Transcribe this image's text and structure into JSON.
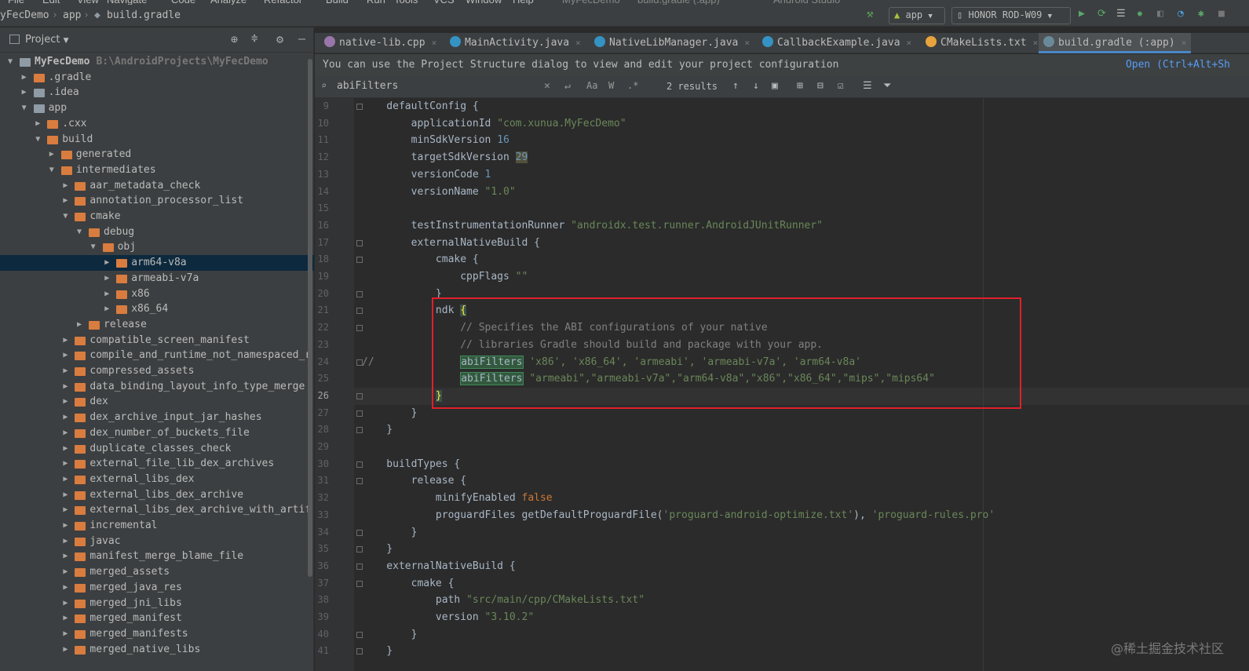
{
  "menu": [
    "File",
    "Edit",
    "View",
    "Navigate",
    "Code",
    "Analyze",
    "Refactor",
    "Build",
    "Run",
    "Tools",
    "VCS",
    "Window",
    "Help",
    "MyFecDemo",
    "build.gradle (:app)",
    "Android Studio"
  ],
  "navbar": {
    "crumbs": [
      "yFecDemo",
      "app",
      "build.gradle"
    ],
    "run_config": "app",
    "device": "HONOR ROD-W09"
  },
  "project_panel": {
    "title": "Project",
    "tree": [
      {
        "label": "MyFecDemo",
        "path": "B:\\AndroidProjects\\MyFecDemo",
        "depth": 0,
        "open": true,
        "grey": true,
        "bold": true
      },
      {
        "label": ".gradle",
        "depth": 1,
        "open": false
      },
      {
        "label": ".idea",
        "depth": 1,
        "open": false,
        "grey": true
      },
      {
        "label": "app",
        "depth": 1,
        "open": true,
        "grey": true
      },
      {
        "label": ".cxx",
        "depth": 2,
        "open": false
      },
      {
        "label": "build",
        "depth": 2,
        "open": true
      },
      {
        "label": "generated",
        "depth": 3,
        "open": false
      },
      {
        "label": "intermediates",
        "depth": 3,
        "open": true
      },
      {
        "label": "aar_metadata_check",
        "depth": 4,
        "open": false
      },
      {
        "label": "annotation_processor_list",
        "depth": 4,
        "open": false
      },
      {
        "label": "cmake",
        "depth": 4,
        "open": true
      },
      {
        "label": "debug",
        "depth": 5,
        "open": true
      },
      {
        "label": "obj",
        "depth": 6,
        "open": true
      },
      {
        "label": "arm64-v8a",
        "depth": 7,
        "open": false,
        "selected": true
      },
      {
        "label": "armeabi-v7a",
        "depth": 7,
        "open": false
      },
      {
        "label": "x86",
        "depth": 7,
        "open": false
      },
      {
        "label": "x86_64",
        "depth": 7,
        "open": false
      },
      {
        "label": "release",
        "depth": 5,
        "open": false
      },
      {
        "label": "compatible_screen_manifest",
        "depth": 4,
        "open": false
      },
      {
        "label": "compile_and_runtime_not_namespaced_r",
        "depth": 4,
        "open": false
      },
      {
        "label": "compressed_assets",
        "depth": 4,
        "open": false
      },
      {
        "label": "data_binding_layout_info_type_merge",
        "depth": 4,
        "open": false
      },
      {
        "label": "dex",
        "depth": 4,
        "open": false
      },
      {
        "label": "dex_archive_input_jar_hashes",
        "depth": 4,
        "open": false
      },
      {
        "label": "dex_number_of_buckets_file",
        "depth": 4,
        "open": false
      },
      {
        "label": "duplicate_classes_check",
        "depth": 4,
        "open": false
      },
      {
        "label": "external_file_lib_dex_archives",
        "depth": 4,
        "open": false
      },
      {
        "label": "external_libs_dex",
        "depth": 4,
        "open": false
      },
      {
        "label": "external_libs_dex_archive",
        "depth": 4,
        "open": false
      },
      {
        "label": "external_libs_dex_archive_with_artif",
        "depth": 4,
        "open": false
      },
      {
        "label": "incremental",
        "depth": 4,
        "open": false
      },
      {
        "label": "javac",
        "depth": 4,
        "open": false
      },
      {
        "label": "manifest_merge_blame_file",
        "depth": 4,
        "open": false
      },
      {
        "label": "merged_assets",
        "depth": 4,
        "open": false
      },
      {
        "label": "merged_java_res",
        "depth": 4,
        "open": false
      },
      {
        "label": "merged_jni_libs",
        "depth": 4,
        "open": false
      },
      {
        "label": "merged_manifest",
        "depth": 4,
        "open": false
      },
      {
        "label": "merged_manifests",
        "depth": 4,
        "open": false
      },
      {
        "label": "merged_native_libs",
        "depth": 4,
        "open": false
      }
    ]
  },
  "tabs": [
    {
      "label": "native-lib.cpp",
      "icon_color": "#9876aa",
      "active": false
    },
    {
      "label": "MainActivity.java",
      "icon_color": "#3592c4",
      "active": false
    },
    {
      "label": "NativeLibManager.java",
      "icon_color": "#3592c4",
      "active": false
    },
    {
      "label": "CallbackExample.java",
      "icon_color": "#3592c4",
      "active": false
    },
    {
      "label": "CMakeLists.txt",
      "icon_color": "#e8a33d",
      "active": false
    },
    {
      "label": "build.gradle (:app)",
      "icon_color": "#6a8a9a",
      "active": true
    }
  ],
  "notice": {
    "text": "You can use the Project Structure dialog to view and edit your project configuration",
    "link": "Open (Ctrl+Alt+Sh"
  },
  "find": {
    "query": "abiFilters",
    "results": "2 results",
    "match_case": "Aa",
    "words": "W",
    "regex": ".*"
  },
  "editor": {
    "current_line": 26,
    "lines": [
      {
        "n": 9,
        "tokens": [
          [
            "ident",
            "    defaultConfig {"
          ]
        ]
      },
      {
        "n": 10,
        "tokens": [
          [
            "ident",
            "        applicationId "
          ],
          [
            "str",
            "\"com.xunua.MyFecDemo\""
          ]
        ]
      },
      {
        "n": 11,
        "tokens": [
          [
            "ident",
            "        minSdkVersion "
          ],
          [
            "num",
            "16"
          ]
        ]
      },
      {
        "n": 12,
        "tokens": [
          [
            "ident",
            "        targetSdkVersion "
          ],
          [
            "warn",
            "29"
          ]
        ]
      },
      {
        "n": 13,
        "tokens": [
          [
            "ident",
            "        versionCode "
          ],
          [
            "num",
            "1"
          ]
        ]
      },
      {
        "n": 14,
        "tokens": [
          [
            "ident",
            "        versionName "
          ],
          [
            "str",
            "\"1.0\""
          ]
        ]
      },
      {
        "n": 15,
        "tokens": []
      },
      {
        "n": 16,
        "tokens": [
          [
            "ident",
            "        testInstrumentationRunner "
          ],
          [
            "str",
            "\"androidx.test.runner.AndroidJUnitRunner\""
          ]
        ]
      },
      {
        "n": 17,
        "tokens": [
          [
            "ident",
            "        externalNativeBuild {"
          ]
        ]
      },
      {
        "n": 18,
        "tokens": [
          [
            "ident",
            "            cmake {"
          ]
        ]
      },
      {
        "n": 19,
        "tokens": [
          [
            "ident",
            "                cppFlags "
          ],
          [
            "str",
            "\"\""
          ]
        ]
      },
      {
        "n": 20,
        "tokens": [
          [
            "ident",
            "            }"
          ]
        ]
      },
      {
        "n": 21,
        "tokens": [
          [
            "ident",
            "            ndk "
          ],
          [
            "brace",
            "{"
          ]
        ]
      },
      {
        "n": 22,
        "tokens": [
          [
            "cmt",
            "                // Specifies the ABI configurations of your native"
          ]
        ]
      },
      {
        "n": 23,
        "tokens": [
          [
            "cmt",
            "                // libraries Gradle should build and package with your app."
          ]
        ]
      },
      {
        "n": 24,
        "tokens": [
          [
            "cmt",
            "//              "
          ],
          [
            "hlo",
            "abiFilters"
          ],
          [
            "str",
            " 'x86', 'x86_64', 'armeabi', 'armeabi-v7a', 'arm64-v8a'"
          ]
        ]
      },
      {
        "n": 25,
        "tokens": [
          [
            "ident",
            "                "
          ],
          [
            "hl",
            "abiFilters"
          ],
          [
            "str",
            " \"armeabi\",\"armeabi-v7a\",\"arm64-v8a\",\"x86\",\"x86_64\",\"mips\",\"mips64\""
          ]
        ]
      },
      {
        "n": 26,
        "tokens": [
          [
            "ident",
            "            "
          ],
          [
            "brace",
            "}"
          ]
        ]
      },
      {
        "n": 27,
        "tokens": [
          [
            "ident",
            "        }"
          ]
        ]
      },
      {
        "n": 28,
        "tokens": [
          [
            "ident",
            "    }"
          ]
        ]
      },
      {
        "n": 29,
        "tokens": []
      },
      {
        "n": 30,
        "tokens": [
          [
            "ident",
            "    buildTypes {"
          ]
        ]
      },
      {
        "n": 31,
        "tokens": [
          [
            "ident",
            "        release {"
          ]
        ]
      },
      {
        "n": 32,
        "tokens": [
          [
            "ident",
            "            minifyEnabled "
          ],
          [
            "kw",
            "false"
          ]
        ]
      },
      {
        "n": 33,
        "tokens": [
          [
            "ident",
            "            proguardFiles getDefaultProguardFile("
          ],
          [
            "str",
            "'proguard-android-optimize.txt'"
          ],
          [
            "ident",
            "), "
          ],
          [
            "str",
            "'proguard-rules.pro'"
          ]
        ]
      },
      {
        "n": 34,
        "tokens": [
          [
            "ident",
            "        }"
          ]
        ]
      },
      {
        "n": 35,
        "tokens": [
          [
            "ident",
            "    }"
          ]
        ]
      },
      {
        "n": 36,
        "tokens": [
          [
            "ident",
            "    externalNativeBuild {"
          ]
        ]
      },
      {
        "n": 37,
        "tokens": [
          [
            "ident",
            "        cmake {"
          ]
        ]
      },
      {
        "n": 38,
        "tokens": [
          [
            "ident",
            "            path "
          ],
          [
            "str",
            "\"src/main/cpp/CMakeLists.txt\""
          ]
        ]
      },
      {
        "n": 39,
        "tokens": [
          [
            "ident",
            "            version "
          ],
          [
            "str",
            "\"3.10.2\""
          ]
        ]
      },
      {
        "n": 40,
        "tokens": [
          [
            "ident",
            "        }"
          ]
        ]
      },
      {
        "n": 41,
        "tokens": [
          [
            "ident",
            "    }"
          ]
        ]
      }
    ]
  },
  "watermark": "@稀土掘金技术社区"
}
